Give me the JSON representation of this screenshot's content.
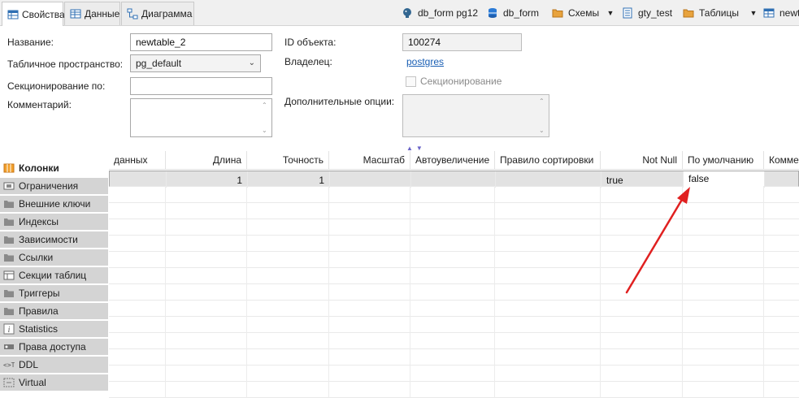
{
  "tabs": [
    {
      "label": "Свойства",
      "active": true,
      "icon": "table-properties-icon"
    },
    {
      "label": "Данные",
      "active": false,
      "icon": "table-data-icon"
    },
    {
      "label": "Диаграмма",
      "active": false,
      "icon": "diagram-icon"
    }
  ],
  "breadcrumbs": [
    {
      "label": "db_form pg12",
      "icon": "postgres-elephant-icon"
    },
    {
      "label": "db_form",
      "icon": "database-icon"
    },
    {
      "label": "Схемы",
      "icon": "folder-icon"
    },
    {
      "label": "gty_test",
      "icon": "schema-icon"
    },
    {
      "label": "Таблицы",
      "icon": "folder-icon"
    },
    {
      "label": "newt",
      "icon": "table-icon"
    }
  ],
  "form": {
    "name_label": "Название:",
    "name_value": "newtable_2",
    "tablespace_label": "Табличное пространство:",
    "tablespace_value": "pg_default",
    "partition_label": "Секционирование по:",
    "partition_value": "",
    "comment_label": "Комментарий:",
    "comment_value": "",
    "object_id_label": "ID объекта:",
    "object_id_value": "100274",
    "owner_label": "Владелец:",
    "owner_value": "postgres",
    "partitioning_checkbox_label": "Секционирование",
    "partitioning_checked": false,
    "extra_options_label": "Дополнительные опции:",
    "extra_options_value": ""
  },
  "side_tabs": [
    {
      "label": "Колонки",
      "active": true,
      "icon": "columns-icon"
    },
    {
      "label": "Ограничения",
      "active": false,
      "icon": "constraints-icon"
    },
    {
      "label": "Внешние ключи",
      "active": false,
      "icon": "folder-icon"
    },
    {
      "label": "Индексы",
      "active": false,
      "icon": "folder-icon"
    },
    {
      "label": "Зависимости",
      "active": false,
      "icon": "folder-icon"
    },
    {
      "label": "Ссылки",
      "active": false,
      "icon": "folder-icon"
    },
    {
      "label": "Секции таблиц",
      "active": false,
      "icon": "table-icon"
    },
    {
      "label": "Триггеры",
      "active": false,
      "icon": "folder-icon"
    },
    {
      "label": "Правила",
      "active": false,
      "icon": "folder-icon"
    },
    {
      "label": "Statistics",
      "active": false,
      "icon": "info-icon"
    },
    {
      "label": "Права доступа",
      "active": false,
      "icon": "key-icon"
    },
    {
      "label": "DDL",
      "active": false,
      "icon": "ddl-icon"
    },
    {
      "label": "Virtual",
      "active": false,
      "icon": "virtual-icon"
    }
  ],
  "grid": {
    "headers": [
      "данных",
      "Длина",
      "Точность",
      "Масштаб",
      "Автоувеличение",
      "Правило сортировки",
      "Not Null",
      "По умолчанию",
      "Комме"
    ],
    "rows": [
      [
        "",
        "1",
        "1",
        "",
        "",
        "",
        "true",
        "false",
        ""
      ]
    ]
  },
  "colors": {
    "accent": "#1a5fb4",
    "annotation_arrow": "#e02020",
    "side_tab_bg": "#d4d4d4",
    "selected_row_bg": "#e2e2e2"
  }
}
